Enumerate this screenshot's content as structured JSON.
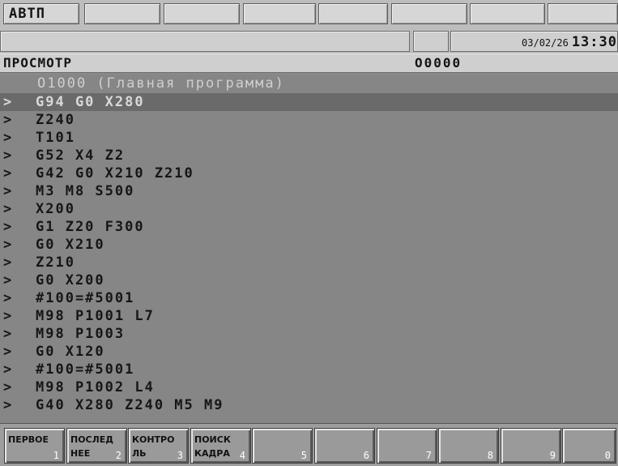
{
  "header": {
    "mode": "АВТП",
    "date": "03/02/26",
    "time": "13:30"
  },
  "title_bar": {
    "screen": "ПРОСМОТР",
    "program_number": "O0000"
  },
  "program": {
    "header": "O1000 (Главная программа)",
    "current_line_index": 0,
    "lines": [
      "G94 G0 X280",
      "Z240",
      "T101",
      "G52 X4 Z2",
      "G42 G0 X210 Z210",
      "M3 M8 S500",
      "X200",
      "G1 Z20 F300",
      "G0 X210",
      "Z210",
      "G0 X200",
      "#100=#5001",
      "M98 P1001 L7",
      "M98 P1003",
      "G0 X120",
      "#100=#5001",
      "M98 P1002 L4",
      "G40 X280 Z240 M5 M9"
    ],
    "line_marker": ">"
  },
  "softkeys": [
    {
      "label": "ПЕРВОЕ",
      "num": "1"
    },
    {
      "label": "ПОСЛЕД\nНЕЕ",
      "num": "2"
    },
    {
      "label": "КОНТРО\nЛЬ",
      "num": "3"
    },
    {
      "label": "ПОИСК\nКАДРА",
      "num": "4"
    },
    {
      "label": "",
      "num": "5"
    },
    {
      "label": "",
      "num": "6"
    },
    {
      "label": "",
      "num": "7"
    },
    {
      "label": "",
      "num": "8"
    },
    {
      "label": "",
      "num": "9"
    },
    {
      "label": "",
      "num": "0"
    }
  ]
}
